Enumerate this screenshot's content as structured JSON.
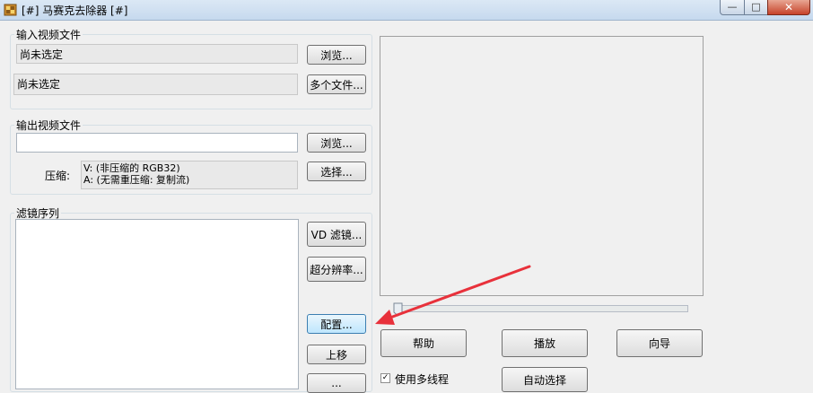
{
  "window": {
    "title": "[#] 马赛克去除器 [#]",
    "close_glyph": "✕",
    "min_glyph": "—",
    "max_glyph": "□"
  },
  "input_group": {
    "label": "输入视频文件",
    "file1_value": "尚未选定",
    "file2_value": "尚未选定",
    "browse_label": "浏览...",
    "multi_label": "多个文件..."
  },
  "output_group": {
    "label": "输出视频文件",
    "file_value": "",
    "browse_label": "浏览...",
    "compress_label": "压缩:",
    "compress_video": "V: (非压缩的 RGB32)",
    "compress_audio": "A: (无需重压缩: 复制流)",
    "select_label": "选择..."
  },
  "filter_group": {
    "label": "滤镜序列",
    "vd_filter_label": "VD 滤镜...",
    "super_res_label": "超分辨率...",
    "config_label": "配置...",
    "move_up_label": "上移",
    "partial_label": "..."
  },
  "player": {
    "help_label": "帮助",
    "play_label": "播放",
    "wizard_label": "向导",
    "multithread_label": "使用多线程",
    "bottom_btn_label": "自动选择"
  },
  "colors": {
    "annotation_arrow": "#e8313b"
  }
}
